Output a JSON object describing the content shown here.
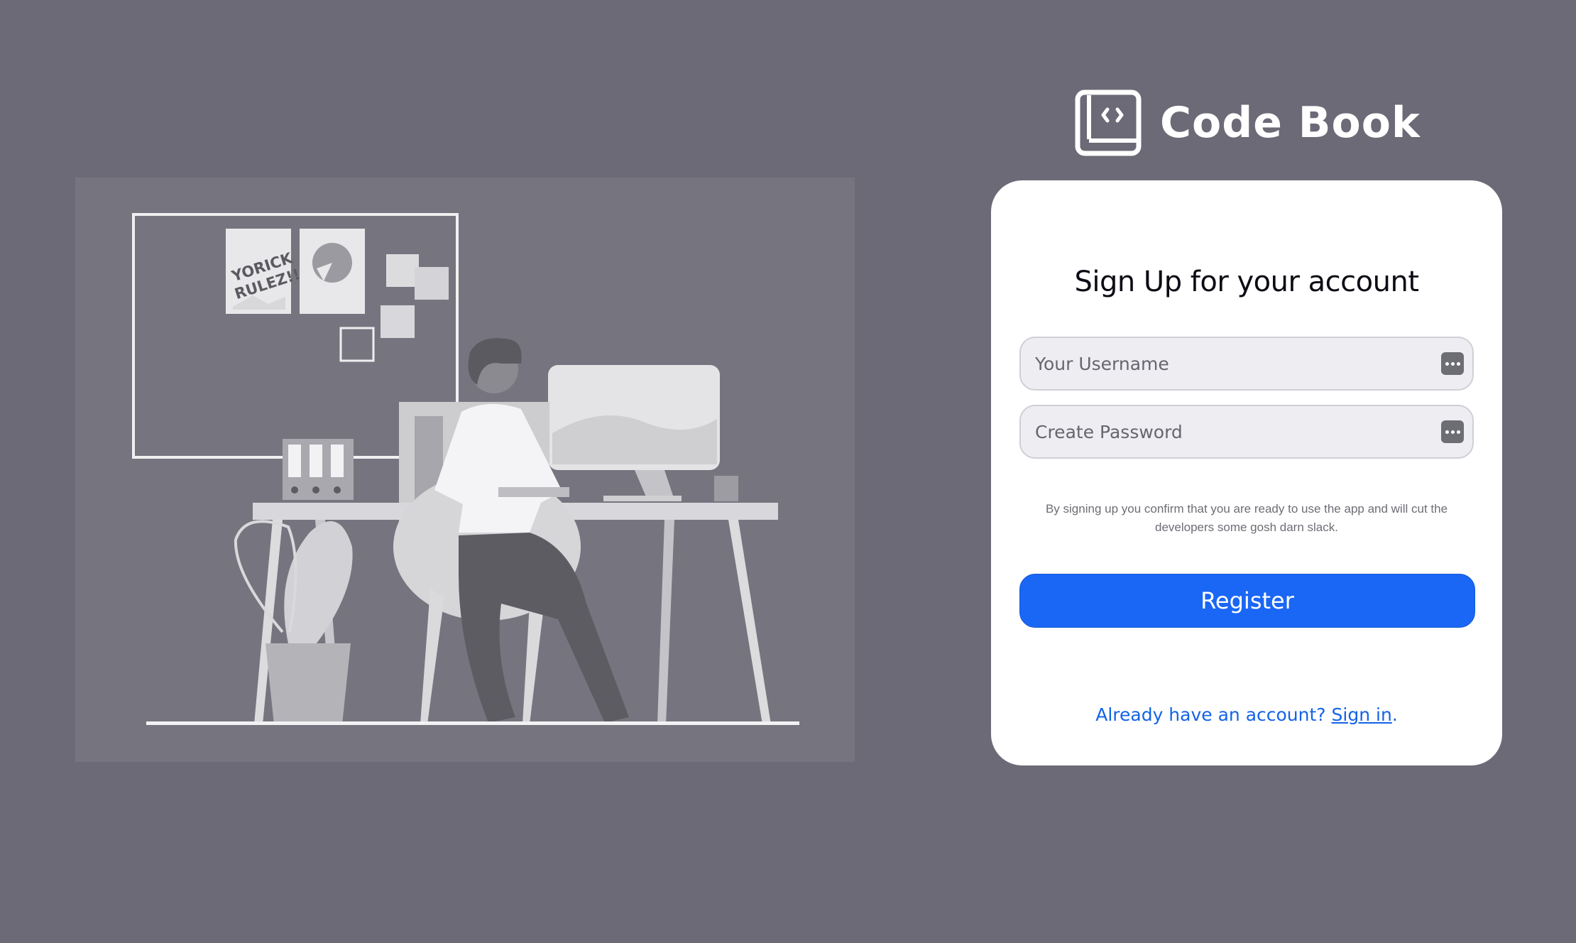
{
  "brand": {
    "name": "Code Book",
    "logo_icon": "code-book-icon"
  },
  "illustration": {
    "description_icon": "office-worker-illustration",
    "poster_text_line1": "YORICK",
    "poster_text_line2": "RULEZ!!!"
  },
  "signup": {
    "title": "Sign Up for your account",
    "username_placeholder": "Your Username",
    "username_value": "",
    "password_placeholder": "Create Password",
    "password_value": "",
    "field_action_icon": "password-manager-icon",
    "disclaimer": "By signing up you confirm that you are ready to use the app and will cut the developers some gosh darn slack.",
    "register_label": "Register",
    "signin_prompt": "Already have an account? ",
    "signin_link": "Sign in",
    "signin_suffix": "."
  },
  "colors": {
    "page_background": "#6b6a76",
    "card_background": "#ffffff",
    "primary_button": "#1a66f5",
    "link": "#1463e6"
  }
}
